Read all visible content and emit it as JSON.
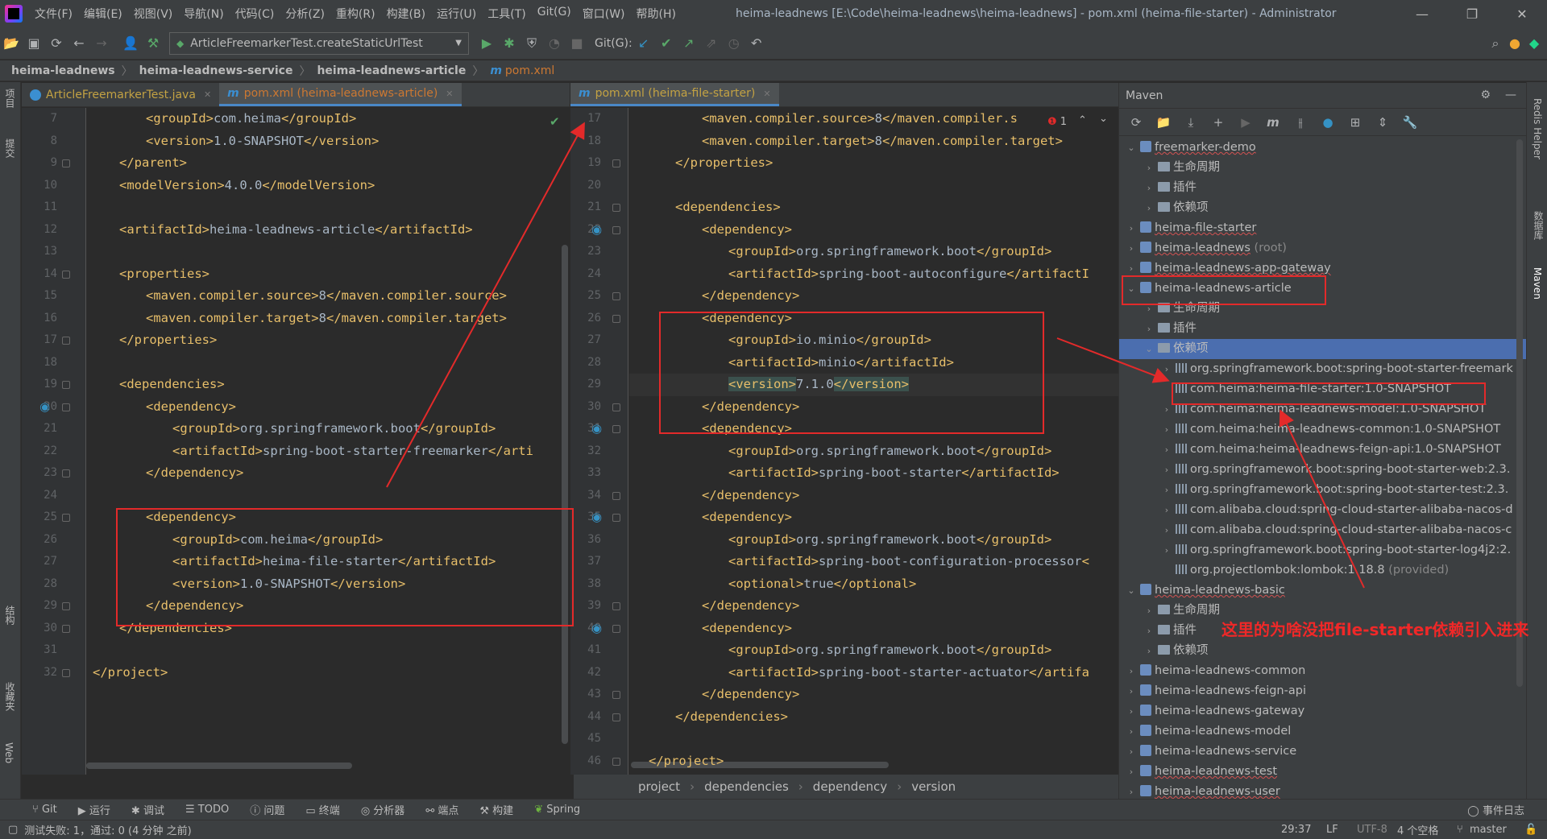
{
  "window": {
    "title": "heima-leadnews [E:\\Code\\heima-leadnews\\heima-leadnews] - pom.xml (heima-file-starter) - Administrator",
    "menu": [
      "文件(F)",
      "编辑(E)",
      "视图(V)",
      "导航(N)",
      "代码(C)",
      "分析(Z)",
      "重构(R)",
      "构建(B)",
      "运行(U)",
      "工具(T)",
      "Git(G)",
      "窗口(W)",
      "帮助(H)"
    ],
    "controls": {
      "minimize": "—",
      "maximize": "❐",
      "close": "✕"
    }
  },
  "toolbar": {
    "run_config": "ArticleFreemarkerTest.createStaticUrlTest",
    "git_label": "Git(G):"
  },
  "navbar": {
    "crumbs": [
      "heima-leadnews",
      "heima-leadnews-service",
      "heima-leadnews-article"
    ],
    "file": "pom.xml",
    "file_icon": "m"
  },
  "left_strip": [
    "项目",
    "提交",
    "结构",
    "收藏夹",
    "Web"
  ],
  "right_strip": [
    "Redis Helper",
    "数据库",
    "Maven"
  ],
  "editor_left": {
    "tabs": [
      {
        "label": "ArticleFreemarkerTest.java"
      },
      {
        "label": "pom.xml (heima-leadnews-article)"
      }
    ],
    "lines": [
      {
        "n": "7",
        "indent": 2,
        "tag1": "<groupId>",
        "text": "com.heima",
        "tag2": "</groupId>"
      },
      {
        "n": "8",
        "indent": 2,
        "tag1": "<version>",
        "text": "1.0-SNAPSHOT",
        "tag2": "</version>"
      },
      {
        "n": "9",
        "indent": 1,
        "tag1": "</parent>",
        "text": "",
        "tag2": ""
      },
      {
        "n": "10",
        "indent": 1,
        "tag1": "<modelVersion>",
        "text": "4.0.0",
        "tag2": "</modelVersion>"
      },
      {
        "n": "11",
        "indent": 0,
        "tag1": "",
        "text": "",
        "tag2": ""
      },
      {
        "n": "12",
        "indent": 1,
        "tag1": "<artifactId>",
        "text": "heima-leadnews-article",
        "tag2": "</artifactId>"
      },
      {
        "n": "13",
        "indent": 0,
        "tag1": "",
        "text": "",
        "tag2": ""
      },
      {
        "n": "14",
        "indent": 1,
        "tag1": "<properties>",
        "text": "",
        "tag2": ""
      },
      {
        "n": "15",
        "indent": 2,
        "tag1": "<maven.compiler.source>",
        "text": "8",
        "tag2": "</maven.compiler.source>"
      },
      {
        "n": "16",
        "indent": 2,
        "tag1": "<maven.compiler.target>",
        "text": "8",
        "tag2": "</maven.compiler.target>"
      },
      {
        "n": "17",
        "indent": 1,
        "tag1": "</properties>",
        "text": "",
        "tag2": ""
      },
      {
        "n": "18",
        "indent": 0,
        "tag1": "",
        "text": "",
        "tag2": ""
      },
      {
        "n": "19",
        "indent": 1,
        "tag1": "<dependencies>",
        "text": "",
        "tag2": ""
      },
      {
        "n": "20",
        "indent": 2,
        "tag1": "<dependency>",
        "text": "",
        "tag2": ""
      },
      {
        "n": "21",
        "indent": 3,
        "tag1": "<groupId>",
        "text": "org.springframework.boot",
        "tag2": "</groupId>"
      },
      {
        "n": "22",
        "indent": 3,
        "tag1": "<artifactId>",
        "text": "spring-boot-starter-freemarker",
        "tag2": "</arti"
      },
      {
        "n": "23",
        "indent": 2,
        "tag1": "</dependency>",
        "text": "",
        "tag2": ""
      },
      {
        "n": "24",
        "indent": 0,
        "tag1": "",
        "text": "",
        "tag2": ""
      },
      {
        "n": "25",
        "indent": 2,
        "tag1": "<dependency>",
        "text": "",
        "tag2": ""
      },
      {
        "n": "26",
        "indent": 3,
        "tag1": "<groupId>",
        "text": "com.heima",
        "tag2": "</groupId>"
      },
      {
        "n": "27",
        "indent": 3,
        "tag1": "<artifactId>",
        "text": "heima-file-starter",
        "tag2": "</artifactId>"
      },
      {
        "n": "28",
        "indent": 3,
        "tag1": "<version>",
        "text": "1.0-SNAPSHOT",
        "tag2": "</version>"
      },
      {
        "n": "29",
        "indent": 2,
        "tag1": "</dependency>",
        "text": "",
        "tag2": ""
      },
      {
        "n": "30",
        "indent": 1,
        "tag1": "</dependencies>",
        "text": "",
        "tag2": ""
      },
      {
        "n": "31",
        "indent": 0,
        "tag1": "",
        "text": "",
        "tag2": ""
      },
      {
        "n": "32",
        "indent": 0,
        "tag1": "</project>",
        "text": "",
        "tag2": ""
      }
    ]
  },
  "editor_right": {
    "tabs": [
      {
        "label": "pom.xml (heima-file-starter)"
      }
    ],
    "error_count": "1",
    "lines": [
      {
        "n": "17",
        "indent": 2,
        "tag1": "<maven.compiler.source>",
        "text": "8",
        "tag2": "</maven.compiler.s"
      },
      {
        "n": "18",
        "indent": 2,
        "tag1": "<maven.compiler.target>",
        "text": "8",
        "tag2": "</maven.compiler.target>"
      },
      {
        "n": "19",
        "indent": 1,
        "tag1": "</properties>",
        "text": "",
        "tag2": ""
      },
      {
        "n": "20",
        "indent": 0,
        "tag1": "",
        "text": "",
        "tag2": ""
      },
      {
        "n": "21",
        "indent": 1,
        "tag1": "<dependencies>",
        "text": "",
        "tag2": ""
      },
      {
        "n": "22",
        "indent": 2,
        "tag1": "<dependency>",
        "text": "",
        "tag2": ""
      },
      {
        "n": "23",
        "indent": 3,
        "tag1": "<groupId>",
        "text": "org.springframework.boot",
        "tag2": "</groupId>"
      },
      {
        "n": "24",
        "indent": 3,
        "tag1": "<artifactId>",
        "text": "spring-boot-autoconfigure",
        "tag2": "</artifactI"
      },
      {
        "n": "25",
        "indent": 2,
        "tag1": "</dependency>",
        "text": "",
        "tag2": ""
      },
      {
        "n": "26",
        "indent": 2,
        "tag1": "<dependency>",
        "text": "",
        "tag2": ""
      },
      {
        "n": "27",
        "indent": 3,
        "tag1": "<groupId>",
        "text": "io.minio",
        "tag2": "</groupId>"
      },
      {
        "n": "28",
        "indent": 3,
        "tag1": "<artifactId>",
        "text": "minio",
        "tag2": "</artifactId>"
      },
      {
        "n": "29",
        "indent": 3,
        "tag1": "<version>",
        "text": "7.1.0",
        "tag2": "</version>"
      },
      {
        "n": "30",
        "indent": 2,
        "tag1": "</dependency>",
        "text": "",
        "tag2": ""
      },
      {
        "n": "31",
        "indent": 2,
        "tag1": "<dependency>",
        "text": "",
        "tag2": ""
      },
      {
        "n": "32",
        "indent": 3,
        "tag1": "<groupId>",
        "text": "org.springframework.boot",
        "tag2": "</groupId>"
      },
      {
        "n": "33",
        "indent": 3,
        "tag1": "<artifactId>",
        "text": "spring-boot-starter",
        "tag2": "</artifactId>"
      },
      {
        "n": "34",
        "indent": 2,
        "tag1": "</dependency>",
        "text": "",
        "tag2": ""
      },
      {
        "n": "35",
        "indent": 2,
        "tag1": "<dependency>",
        "text": "",
        "tag2": ""
      },
      {
        "n": "36",
        "indent": 3,
        "tag1": "<groupId>",
        "text": "org.springframework.boot",
        "tag2": "</groupId>"
      },
      {
        "n": "37",
        "indent": 3,
        "tag1": "<artifactId>",
        "text": "spring-boot-configuration-processor",
        "tag2": "<"
      },
      {
        "n": "38",
        "indent": 3,
        "tag1": "<optional>",
        "text": "true",
        "tag2": "</optional>"
      },
      {
        "n": "39",
        "indent": 2,
        "tag1": "</dependency>",
        "text": "",
        "tag2": ""
      },
      {
        "n": "40",
        "indent": 2,
        "tag1": "<dependency>",
        "text": "",
        "tag2": ""
      },
      {
        "n": "41",
        "indent": 3,
        "tag1": "<groupId>",
        "text": "org.springframework.boot",
        "tag2": "</groupId>"
      },
      {
        "n": "42",
        "indent": 3,
        "tag1": "<artifactId>",
        "text": "spring-boot-starter-actuator",
        "tag2": "</artifa"
      },
      {
        "n": "43",
        "indent": 2,
        "tag1": "</dependency>",
        "text": "",
        "tag2": ""
      },
      {
        "n": "44",
        "indent": 1,
        "tag1": "</dependencies>",
        "text": "",
        "tag2": ""
      },
      {
        "n": "45",
        "indent": 0,
        "tag1": "",
        "text": "",
        "tag2": ""
      },
      {
        "n": "46",
        "indent": 0,
        "tag1": "</project>",
        "text": "",
        "tag2": ""
      }
    ],
    "breadcrumbs": [
      "project",
      "dependencies",
      "dependency",
      "version"
    ]
  },
  "maven": {
    "title": "Maven",
    "tree": [
      {
        "level": 0,
        "arrow": "▾",
        "icon": "proj",
        "label": "freemarker-demo",
        "squig": true
      },
      {
        "level": 1,
        "arrow": "›",
        "icon": "fold",
        "label": "生命周期"
      },
      {
        "level": 1,
        "arrow": "›",
        "icon": "fold",
        "label": "插件"
      },
      {
        "level": 1,
        "arrow": "›",
        "icon": "fold",
        "label": "依赖项"
      },
      {
        "level": 0,
        "arrow": "›",
        "icon": "proj",
        "label": "heima-file-starter",
        "squig": true
      },
      {
        "level": 0,
        "arrow": "›",
        "icon": "proj",
        "label": "heima-leadnews",
        "suffix": " (root)",
        "squig": true
      },
      {
        "level": 0,
        "arrow": "›",
        "icon": "proj",
        "label": "heima-leadnews-app-gateway",
        "squig": true
      },
      {
        "level": 0,
        "arrow": "▾",
        "icon": "proj",
        "label": "heima-leadnews-article"
      },
      {
        "level": 1,
        "arrow": "›",
        "icon": "fold",
        "label": "生命周期"
      },
      {
        "level": 1,
        "arrow": "›",
        "icon": "fold",
        "label": "插件"
      },
      {
        "level": 1,
        "arrow": "▾",
        "icon": "fold",
        "label": "依赖项",
        "selected": true
      },
      {
        "level": 2,
        "arrow": "›",
        "icon": "dep",
        "label": "org.springframework.boot:spring-boot-starter-freemark"
      },
      {
        "level": 2,
        "arrow": "",
        "icon": "dep",
        "label": "com.heima:heima-file-starter:1.0-SNAPSHOT"
      },
      {
        "level": 2,
        "arrow": "›",
        "icon": "dep",
        "label": "com.heima:heima-leadnews-model:1.0-SNAPSHOT"
      },
      {
        "level": 2,
        "arrow": "›",
        "icon": "dep",
        "label": "com.heima:heima-leadnews-common:1.0-SNAPSHOT"
      },
      {
        "level": 2,
        "arrow": "›",
        "icon": "dep",
        "label": "com.heima:heima-leadnews-feign-api:1.0-SNAPSHOT"
      },
      {
        "level": 2,
        "arrow": "›",
        "icon": "dep",
        "label": "org.springframework.boot:spring-boot-starter-web:2.3."
      },
      {
        "level": 2,
        "arrow": "›",
        "icon": "dep",
        "label": "org.springframework.boot:spring-boot-starter-test:2.3."
      },
      {
        "level": 2,
        "arrow": "›",
        "icon": "dep",
        "label": "com.alibaba.cloud:spring-cloud-starter-alibaba-nacos-d"
      },
      {
        "level": 2,
        "arrow": "›",
        "icon": "dep",
        "label": "com.alibaba.cloud:spring-cloud-starter-alibaba-nacos-c"
      },
      {
        "level": 2,
        "arrow": "›",
        "icon": "dep",
        "label": "org.springframework.boot:spring-boot-starter-log4j2:2."
      },
      {
        "level": 2,
        "arrow": "",
        "icon": "dep",
        "label": "org.projectlombok:lombok:1.18.8",
        "suffix": " (provided)"
      },
      {
        "level": 0,
        "arrow": "▾",
        "icon": "proj",
        "label": "heima-leadnews-basic",
        "squig": true
      },
      {
        "level": 1,
        "arrow": "›",
        "icon": "fold",
        "label": "生命周期"
      },
      {
        "level": 1,
        "arrow": "›",
        "icon": "fold",
        "label": "插件"
      },
      {
        "level": 1,
        "arrow": "›",
        "icon": "fold",
        "label": "依赖项"
      },
      {
        "level": 0,
        "arrow": "›",
        "icon": "proj",
        "label": "heima-leadnews-common"
      },
      {
        "level": 0,
        "arrow": "›",
        "icon": "proj",
        "label": "heima-leadnews-feign-api"
      },
      {
        "level": 0,
        "arrow": "›",
        "icon": "proj",
        "label": "heima-leadnews-gateway"
      },
      {
        "level": 0,
        "arrow": "›",
        "icon": "proj",
        "label": "heima-leadnews-model"
      },
      {
        "level": 0,
        "arrow": "›",
        "icon": "proj",
        "label": "heima-leadnews-service"
      },
      {
        "level": 0,
        "arrow": "›",
        "icon": "proj",
        "label": "heima-leadnews-test",
        "squig": true
      },
      {
        "level": 0,
        "arrow": "›",
        "icon": "proj",
        "label": "heima-leadnews-user",
        "squig": true
      }
    ]
  },
  "annotation": {
    "text": "这里的为啥没把file-starter依赖引入进来"
  },
  "bottom_tools": [
    "Git",
    "运行",
    "调试",
    "TODO",
    "问题",
    "终端",
    "分析器",
    "端点",
    "构建",
    "Spring"
  ],
  "status": {
    "message": "测试失败: 1，通过: 0 (4 分钟 之前)",
    "position": "29:37",
    "line_sep": "LF",
    "encoding": "UTF-8",
    "indent": "4 个空格",
    "branch": "master",
    "event_log": "事件日志"
  },
  "colors": {
    "tag": "#e8bf6a",
    "text": "#a9b7c6",
    "selection": "#4b6eaf",
    "annotation_red": "#e32a2a"
  }
}
